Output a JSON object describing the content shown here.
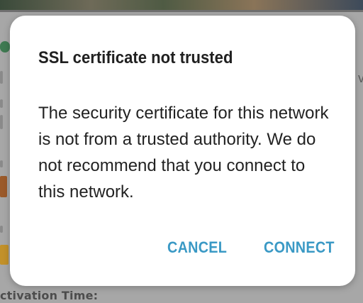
{
  "background": {
    "right_fragment": "v",
    "bottom_fragment": "ctivation Time:"
  },
  "dialog": {
    "title": "SSL certificate not trusted",
    "message": "The security certificate for this network is not from a trusted authority. We do not recommend that you connect to this network.",
    "cancel_label": "CANCEL",
    "connect_label": "CONNECT"
  },
  "colors": {
    "accent": "#3a99c5",
    "scrim": "#a7a7a7"
  }
}
